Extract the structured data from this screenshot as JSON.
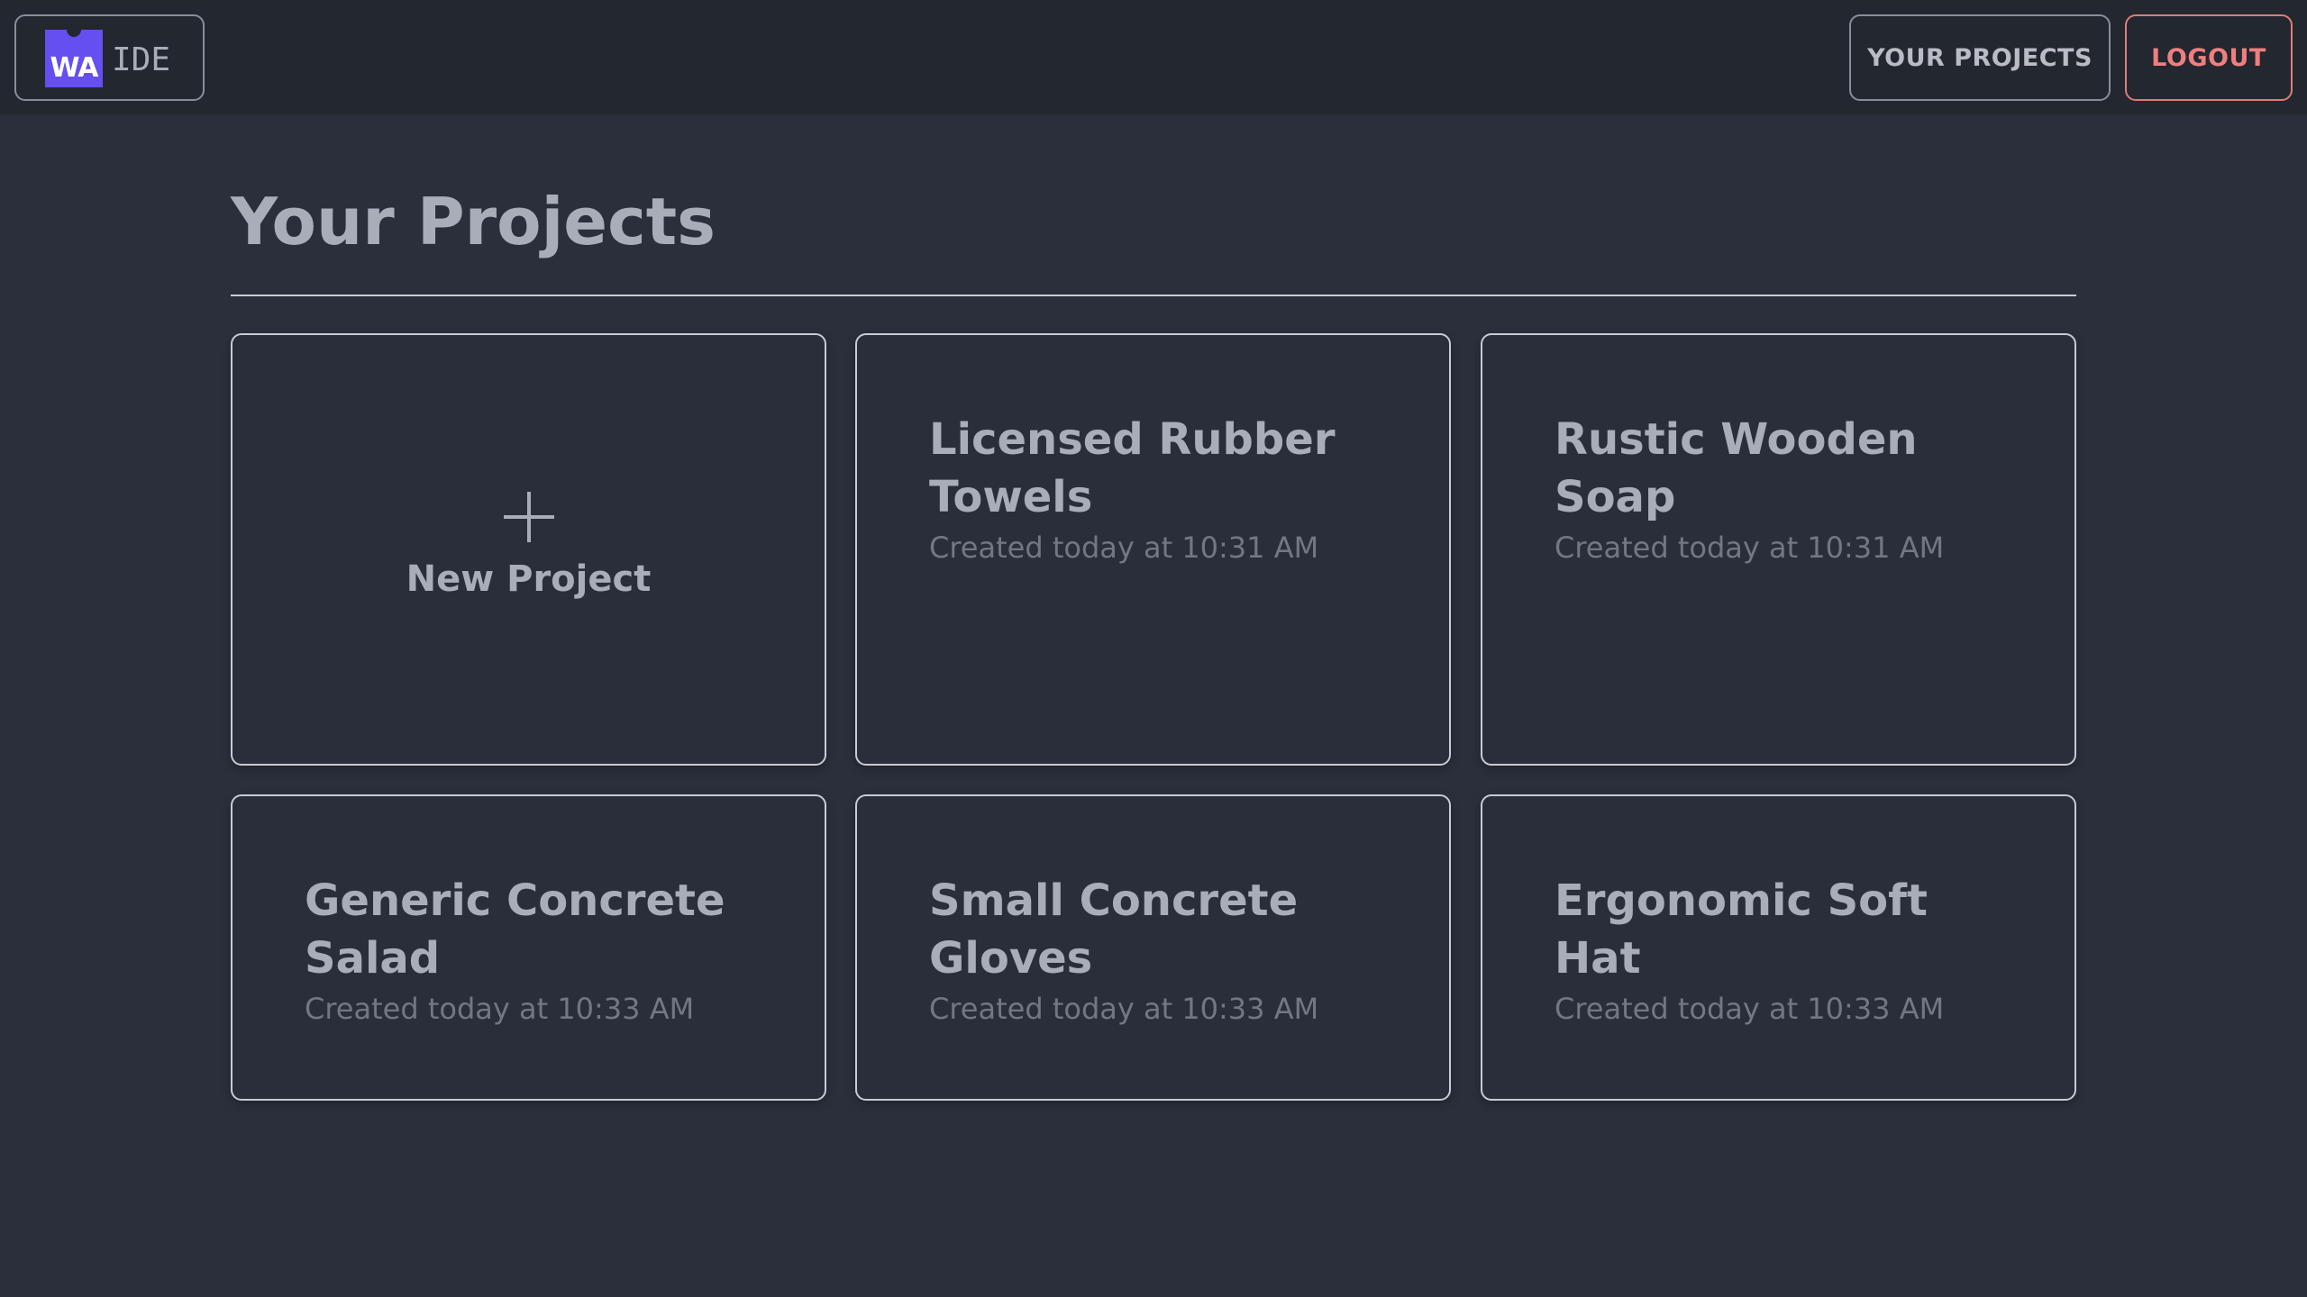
{
  "header": {
    "logo_mark": "WA",
    "logo_text": "IDE",
    "nav": {
      "projects_label": "YOUR PROJECTS",
      "logout_label": "LOGOUT"
    }
  },
  "main": {
    "title": "Your Projects",
    "new_project_label": "New Project",
    "projects": [
      {
        "name": "Licensed Rubber Towels",
        "created": "Created today at 10:31 AM"
      },
      {
        "name": "Rustic Wooden Soap",
        "created": "Created today at 10:31 AM"
      },
      {
        "name": "Generic Concrete Salad",
        "created": "Created today at 10:33 AM"
      },
      {
        "name": "Small Concrete Gloves",
        "created": "Created today at 10:33 AM"
      },
      {
        "name": "Ergonomic Soft Hat",
        "created": "Created today at 10:33 AM"
      }
    ]
  },
  "colors": {
    "background": "#2a2f3b",
    "topbar": "#232730",
    "brand": "#654ff0",
    "logout_accent": "#ef7f7f"
  }
}
